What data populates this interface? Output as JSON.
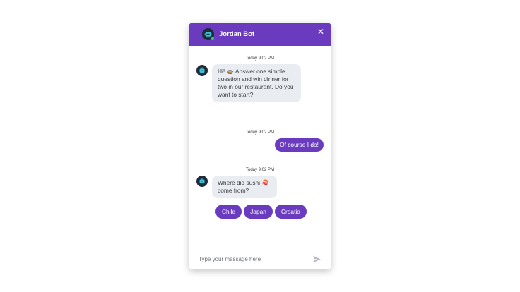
{
  "header": {
    "title": "Jordan Bot",
    "close_label": "✕"
  },
  "messages": [
    {
      "time": "Today 9:02 PM",
      "sender": "bot",
      "text": "Hi! 🍲 Answer one simple question and win dinner for two in our restaurant. Do you want to start?"
    },
    {
      "time": "Today 9:02 PM",
      "sender": "user",
      "text": "Of course I do!"
    },
    {
      "time": "Today 9:02 PM",
      "sender": "bot",
      "text": "Where did sushi 🍣 come from?"
    }
  ],
  "quick_replies": [
    "Chile",
    "Japan",
    "Croatia"
  ],
  "composer": {
    "placeholder": "Type your message here"
  },
  "icons": {
    "avatar": "robot-icon",
    "close": "close-icon",
    "send": "send-icon"
  },
  "colors": {
    "brand": "#6a3bbf",
    "bot_bubble": "#e9edf2",
    "online": "#2fd07a"
  }
}
